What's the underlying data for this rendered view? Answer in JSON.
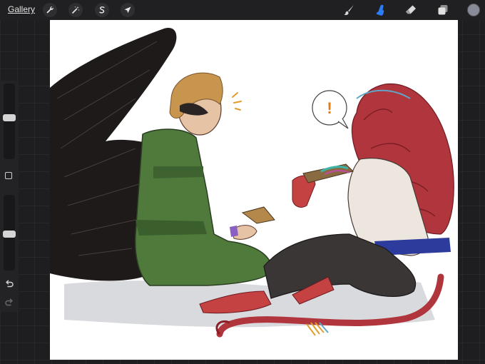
{
  "topbar": {
    "gallery_label": "Gallery",
    "left_tools": [
      {
        "name": "actions",
        "icon": "wrench-icon"
      },
      {
        "name": "adjustments",
        "icon": "magic-wand-icon"
      },
      {
        "name": "selection",
        "icon": "selection-s-icon"
      },
      {
        "name": "transform",
        "icon": "arrow-cursor-icon"
      }
    ],
    "right_tools": [
      {
        "name": "brush",
        "icon": "brush-icon",
        "active": false
      },
      {
        "name": "smudge",
        "icon": "smudge-finger-icon",
        "active": true
      },
      {
        "name": "eraser",
        "icon": "eraser-icon",
        "active": false
      },
      {
        "name": "layers",
        "icon": "layers-icon",
        "active": false
      }
    ],
    "current_color": "#8a8b99",
    "accent_color": "#2d7cf6"
  },
  "sidebar": {
    "brush_size": 0.45,
    "opacity": 0.4,
    "undo_icon": "undo-icon",
    "redo_icon": "redo-icon"
  },
  "canvas": {
    "background": "#ffffff",
    "speech_bubble_text": "!"
  }
}
